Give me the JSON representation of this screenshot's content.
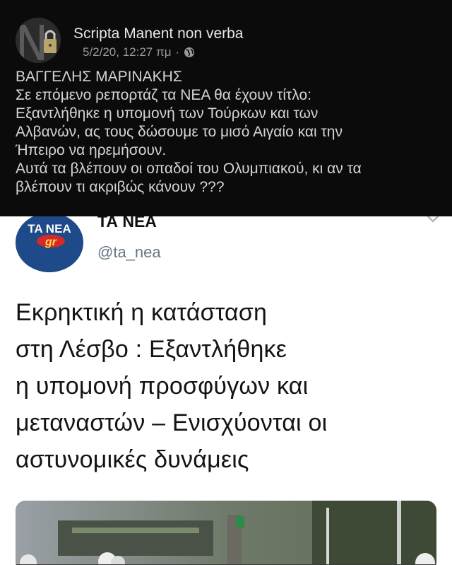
{
  "facebook_post": {
    "page_name": "Scripta Manent non verba",
    "timestamp": "5/2/20, 12:27 πμ",
    "separator": "·",
    "privacy_icon": "globe-icon",
    "text_lines": [
      "ΒΑΓΓΕΛΗΣ ΜΑΡΙΝΑΚΗΣ",
      "Σε επόμενο ρεπορτάζ τα ΝΕΑ θα έχουν τίτλο:",
      "Εξαντλήθηκε η υπομονή των Τούρκων και των",
      "Αλβανών, ας τους δώσουμε το μισό Αιγαίο και την",
      "Ήπειρο να ηρεμήσουν.",
      "Αυτά τα βλέπουν οι οπαδοί του Ολυμπιακού, κι αν τα",
      "βλέπουν τι ακριβώς κάνουν ???"
    ]
  },
  "tweet": {
    "avatar_logo_text": "TA NEA",
    "avatar_logo_sub": "gr",
    "display_name": "ΤΑ ΝΕΑ",
    "handle": "@ta_nea",
    "headline_lines": [
      "Εκρηκτική η κατάσταση",
      "στη Λέσβο : Εξαντλήθηκε",
      "η υπομονή προσφύγων και",
      "μεταναστών – Ενισχύονται οι",
      "αστυνομικές δυνάμεις"
    ]
  },
  "colors": {
    "fb_background": "#0b0b0b",
    "handle_gray": "#657786",
    "logo_blue": "#1f4a8a",
    "logo_red": "#d42a2a"
  }
}
